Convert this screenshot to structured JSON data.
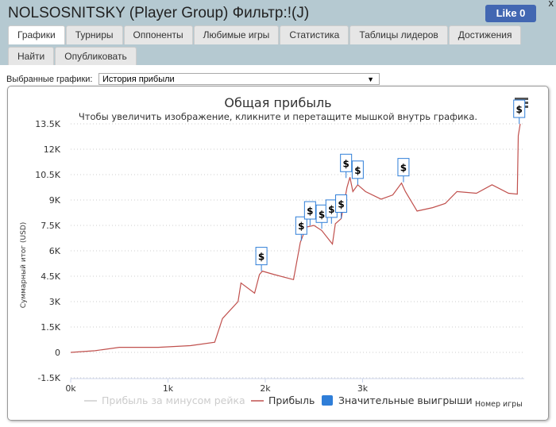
{
  "header": {
    "title": "NOLSOSNITSKY (Player Group) Фильтр:!(J)",
    "close": "x",
    "like_label": "Like 0"
  },
  "tabs": [
    {
      "label": "Графики",
      "active": true
    },
    {
      "label": "Турниры"
    },
    {
      "label": "Оппоненты"
    },
    {
      "label": "Любимые игры"
    },
    {
      "label": "Статистика"
    },
    {
      "label": "Таблицы лидеров"
    },
    {
      "label": "Достижения"
    },
    {
      "label": "Найти"
    },
    {
      "label": "Опубликовать"
    }
  ],
  "selector": {
    "label": "Выбранные графики:",
    "value": "История прибыли"
  },
  "chart_data": {
    "type": "line",
    "title": "Общая прибыль",
    "subtitle": "Чтобы увеличить изображение, кликните и перетащите мышкой внутрь графика.",
    "xlabel": "Номер игры",
    "ylabel": "Суммарный итог (USD)",
    "xlim": [
      0,
      4650
    ],
    "ylim": [
      -1500,
      13500
    ],
    "x_ticks": [
      "0k",
      "1k",
      "2k",
      "3k"
    ],
    "y_ticks": [
      "13.5K",
      "12K",
      "10.5K",
      "9K",
      "7.5K",
      "6K",
      "4.5K",
      "3K",
      "1.5K",
      "0",
      "-1.5K"
    ],
    "grid": true,
    "legend": {
      "position": "bottom",
      "items": [
        {
          "label": "Прибыль за минусом рейка",
          "color": "#cccccc",
          "hidden": true
        },
        {
          "label": "Прибыль",
          "color": "#c0504d"
        },
        {
          "label": "Значительные выигрыши",
          "color": "#2f7ed8"
        }
      ]
    },
    "series": [
      {
        "name": "Прибыль",
        "color": "#c0504d",
        "x": [
          0,
          250,
          500,
          900,
          1230,
          1480,
          1560,
          1720,
          1750,
          1890,
          1940,
          1970,
          2090,
          2290,
          2360,
          2420,
          2500,
          2580,
          2690,
          2720,
          2780,
          2840,
          2870,
          2900,
          2950,
          3030,
          3190,
          3310,
          3400,
          3440,
          3560,
          3720,
          3850,
          3970,
          4170,
          4330,
          4500,
          4590,
          4600,
          4620
        ],
        "y": [
          0,
          100,
          300,
          300,
          400,
          600,
          2000,
          3000,
          4100,
          3500,
          4600,
          4800,
          4600,
          4300,
          6500,
          7400,
          7500,
          7200,
          6400,
          7600,
          7900,
          9750,
          10350,
          9500,
          9900,
          9500,
          9050,
          9300,
          10000,
          9500,
          8350,
          8550,
          8800,
          9500,
          9400,
          9900,
          9400,
          9350,
          12800,
          13500
        ]
      }
    ],
    "flags": {
      "symbol": "$",
      "x": [
        1960,
        2370,
        2460,
        2580,
        2680,
        2780,
        2830,
        2950,
        3420,
        4610
      ],
      "y": [
        4800,
        6600,
        7500,
        7300,
        7600,
        7900,
        10300,
        9900,
        10050,
        13500
      ]
    },
    "menu_icon": "hamburger-icon"
  }
}
